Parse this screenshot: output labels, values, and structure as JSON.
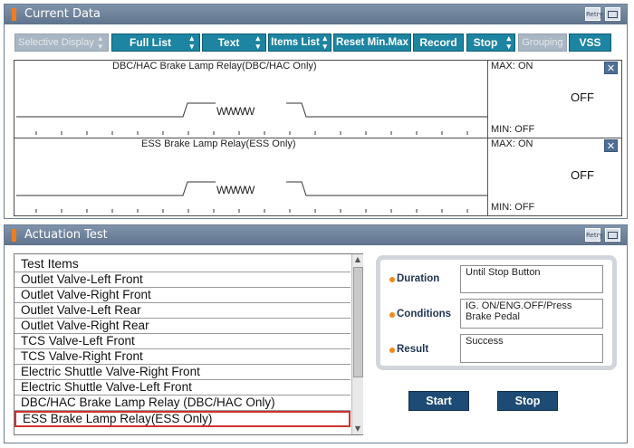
{
  "current_data": {
    "title": "Current Data",
    "retry_label": "Retry",
    "toolbar": [
      {
        "label": "Selective Display",
        "dropdown": true,
        "enabled": false
      },
      {
        "label": "Full List",
        "dropdown": true,
        "enabled": true
      },
      {
        "label": "Text",
        "dropdown": true,
        "enabled": true
      },
      {
        "label": "Items List",
        "dropdown": true,
        "enabled": true
      },
      {
        "label": "Reset Min.Max",
        "dropdown": false,
        "enabled": true
      },
      {
        "label": "Record",
        "dropdown": false,
        "enabled": true
      },
      {
        "label": "Stop",
        "dropdown": true,
        "enabled": true
      },
      {
        "label": "Grouping",
        "dropdown": false,
        "enabled": false
      },
      {
        "label": "VSS",
        "dropdown": false,
        "enabled": true
      }
    ],
    "graphs": [
      {
        "title": "DBC/HAC Brake Lamp Relay(DBC/HAC Only)",
        "max": "MAX: ON",
        "min": "MIN: OFF",
        "value": "OFF",
        "wave_text": "WWWW"
      },
      {
        "title": "ESS Brake Lamp Relay(ESS Only)",
        "max": "MAX: ON",
        "min": "MIN: OFF",
        "value": "OFF",
        "wave_text": "WWWW"
      }
    ],
    "close_glyph": "✕"
  },
  "actuation": {
    "title": "Actuation Test",
    "retry_label": "Retry",
    "list_header": "Test Items",
    "items": [
      "Outlet Valve-Left Front",
      "Outlet Valve-Right Front",
      "Outlet Valve-Left Rear",
      "Outlet Valve-Right Rear",
      "TCS Valve-Left Front",
      "TCS Valve-Right Front",
      "Electric Shuttle Valve-Right Front",
      "Electric Shuttle Valve-Left Front",
      "DBC/HAC Brake Lamp Relay (DBC/HAC Only)",
      "ESS Brake Lamp Relay(ESS Only)"
    ],
    "selected_index": 9,
    "details": {
      "duration_label": "Duration",
      "duration_value": "Until Stop Button",
      "conditions_label": "Conditions",
      "conditions_value": "IG. ON/ENG.OFF/Press Brake Pedal",
      "result_label": "Result",
      "result_value": "Success"
    },
    "start_label": "Start",
    "stop_label": "Stop"
  },
  "colors": {
    "titlebar": "#6a7d93",
    "accent": "#f07c1f",
    "toolbar_button": "#1d84a1",
    "action_button": "#1e4b74",
    "selection_border": "#d0322e"
  }
}
